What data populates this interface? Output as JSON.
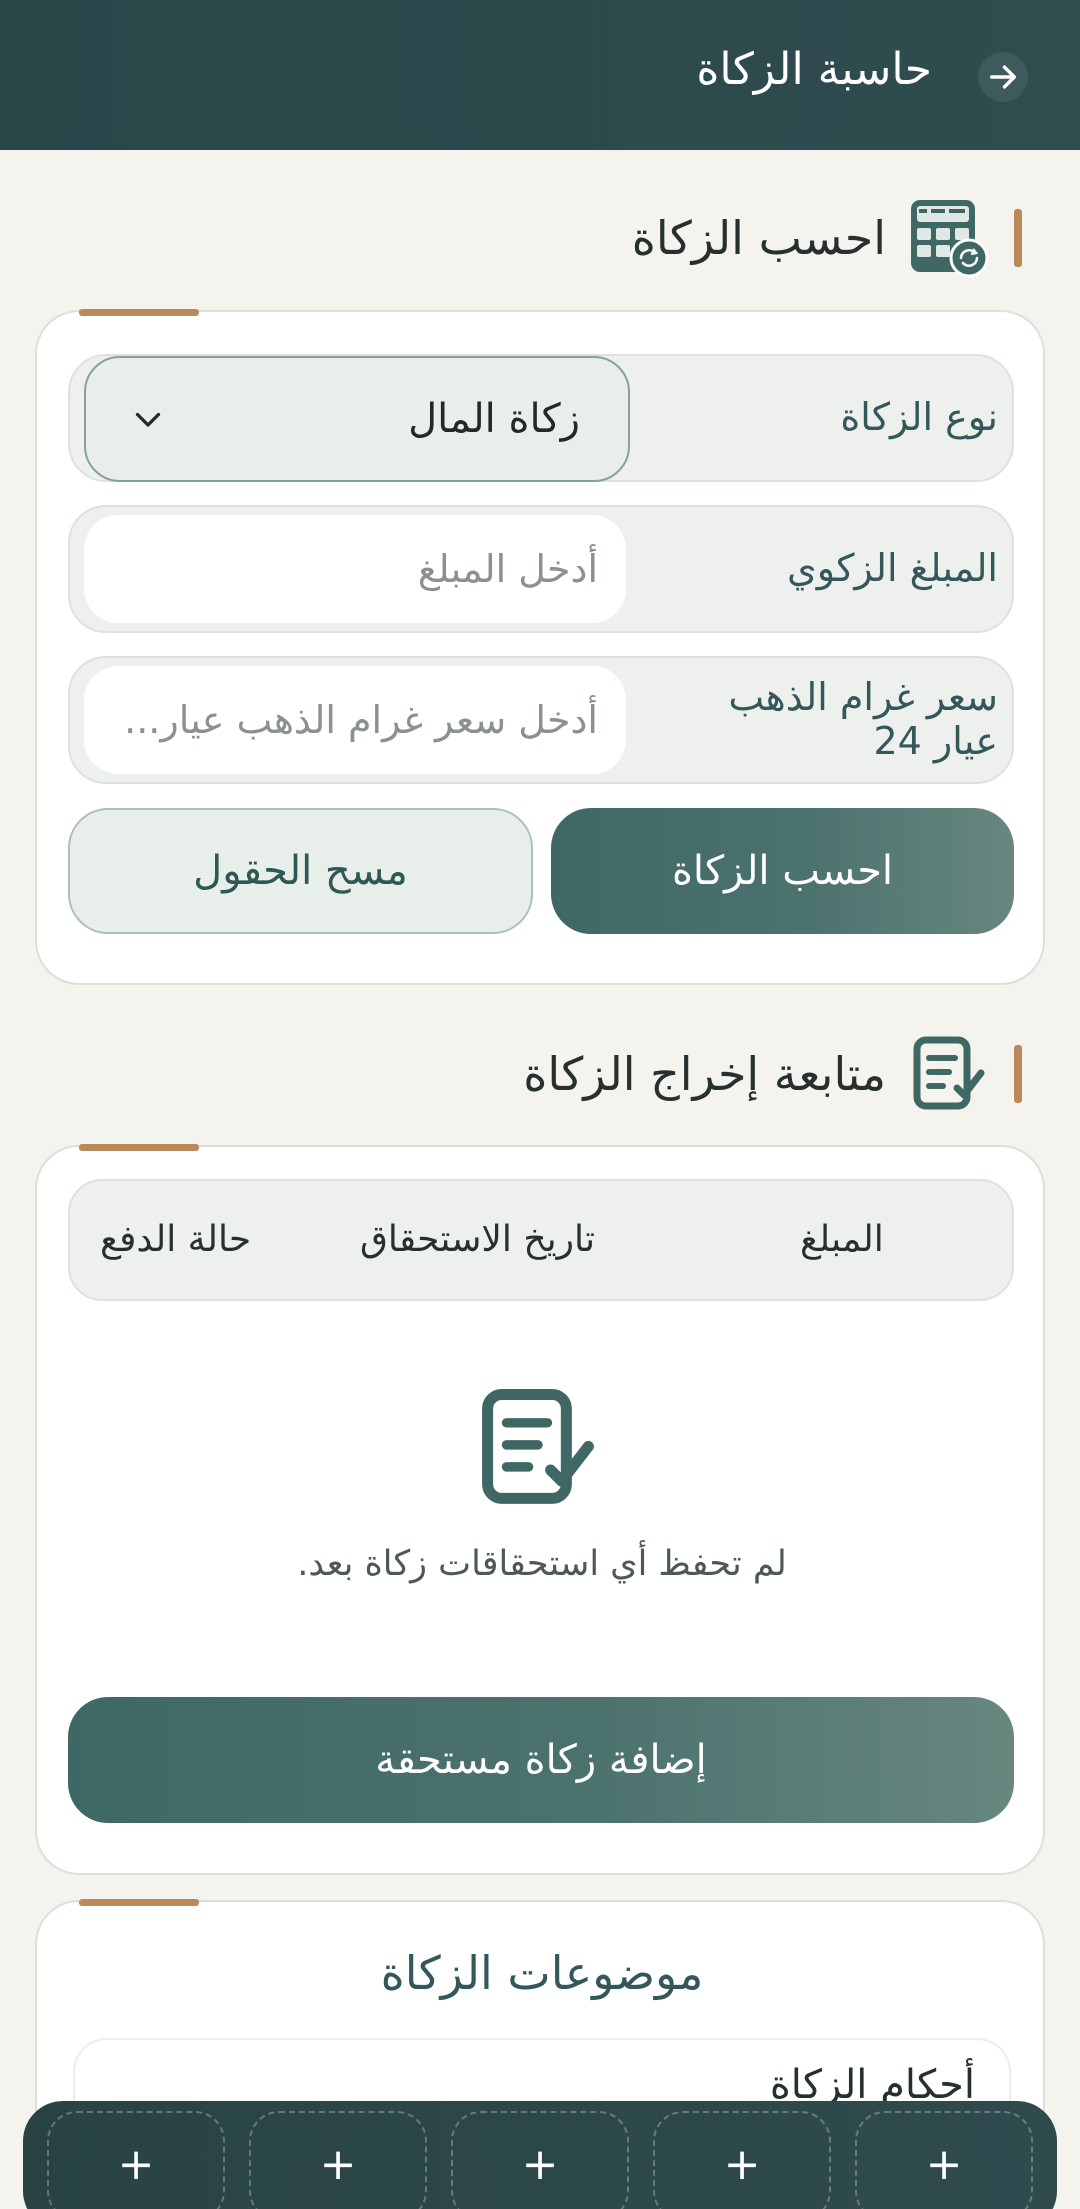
{
  "header": {
    "title": "حاسبة الزكاة",
    "back_icon": "arrow-right-icon"
  },
  "calculator": {
    "title": "احسب الزكاة",
    "icon": "calculator-icon",
    "type_label": "نوع الزكاة",
    "type_value": "زكاة المال",
    "amount_label": "المبلغ الزكوي",
    "amount_placeholder": "أدخل المبلغ",
    "gold_label": "سعر غرام الذهب عيار 24",
    "gold_placeholder": "أدخل سعر غرام الذهب عيار...",
    "calculate_button": "احسب الزكاة",
    "clear_button": "مسح الحقول"
  },
  "tracking": {
    "title": "متابعة إخراج الزكاة",
    "icon": "checklist-icon",
    "columns": [
      "المبلغ",
      "تاريخ الاستحقاق",
      "حالة الدفع"
    ],
    "empty_text": "لم تحفظ أي استحقاقات زكاة بعد.",
    "add_button": "إضافة زكاة مستحقة"
  },
  "topics": {
    "title": "موضوعات الزكاة",
    "first_item": "أحكام الزكاة"
  },
  "bottom_bar": {
    "slots": [
      "+",
      "+",
      "+",
      "+",
      "+"
    ]
  },
  "colors": {
    "primary": "#3f6865",
    "accent": "#b98b5a",
    "background": "#f4f3ee",
    "header": "#2a4649"
  }
}
